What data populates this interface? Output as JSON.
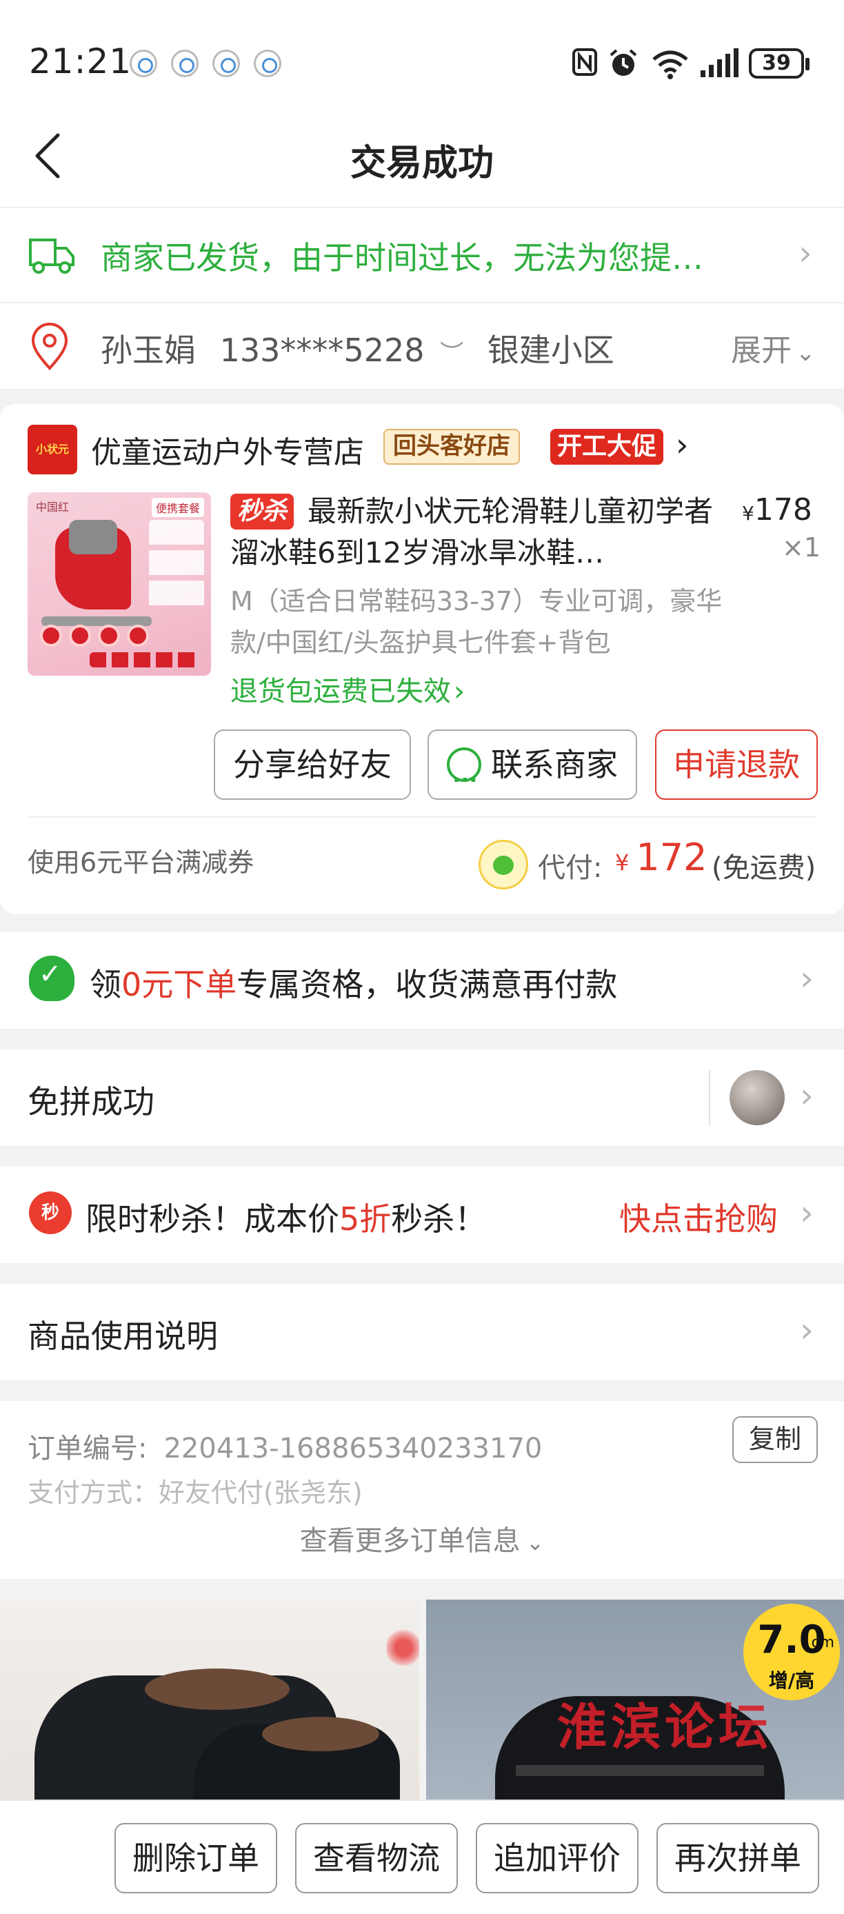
{
  "status_bar": {
    "time": "21:21",
    "battery": "39",
    "icons": [
      "nfc-icon",
      "alarm-icon",
      "wifi-icon",
      "signal-icon",
      "battery-icon"
    ]
  },
  "header": {
    "title": "交易成功",
    "back_icon": "chevron-left-icon"
  },
  "shipping": {
    "text": "商家已发货，由于时间过长，无法为您提…",
    "icon": "truck-icon"
  },
  "address": {
    "name": "孙玉娟",
    "phone": "133****5228",
    "location": "银建小区",
    "expand": "展开"
  },
  "order": {
    "shop": {
      "logo_text": "小状元",
      "name": "优童运动户外专营店",
      "tag_returning": "回头客好店",
      "tag_promo": "开工大促"
    },
    "product": {
      "image_label_left": "中国红",
      "image_label_right": "便携套餐",
      "flash_tag": "秒杀",
      "title": "最新款小状元轮滑鞋儿童初学者溜冰鞋6到12岁滑冰旱冰鞋…",
      "price_symbol": "¥",
      "price": "178",
      "quantity": "×1",
      "spec": "M（适合日常鞋码33-37）专业可调，豪华款/中国红/头盔护具七件套+背包",
      "return_note": "退货包运费已失效"
    },
    "buttons": {
      "share": "分享给好友",
      "contact": "联系商家",
      "refund": "申请退款"
    },
    "coupon": "使用6元平台满减券",
    "payment": {
      "label": "代付:",
      "symbol": "¥",
      "amount": "172",
      "note": "(免运费)"
    }
  },
  "rows": {
    "free_order": {
      "prefix": "领",
      "highlight": "0元下单",
      "suffix": "专属资格，收货满意再付款"
    },
    "group": {
      "text": "免拼成功"
    },
    "flash_sale": {
      "icon_text": "秒",
      "prefix": "限时秒杀！成本价",
      "highlight": "5折",
      "suffix": "秒杀！",
      "cta": "快点击抢购"
    },
    "usage": {
      "text": "商品使用说明"
    }
  },
  "order_info": {
    "order_no_label": "订单编号:",
    "order_no": "220413-168865340233170",
    "copy": "复制",
    "pay_method": "支付方式：好友代付(张尧东)",
    "more": "查看更多订单信息"
  },
  "recommendations": {
    "watermark": "淮滨论坛",
    "badge_value": "7.0",
    "badge_unit": "cm",
    "badge_sub": "增/高"
  },
  "bottom_bar": {
    "delete": "删除订单",
    "logistics": "查看物流",
    "review": "追加评价",
    "reorder": "再次拼单"
  },
  "colors": {
    "accent_red": "#e0392c",
    "accent_green": "#2daf3d"
  }
}
